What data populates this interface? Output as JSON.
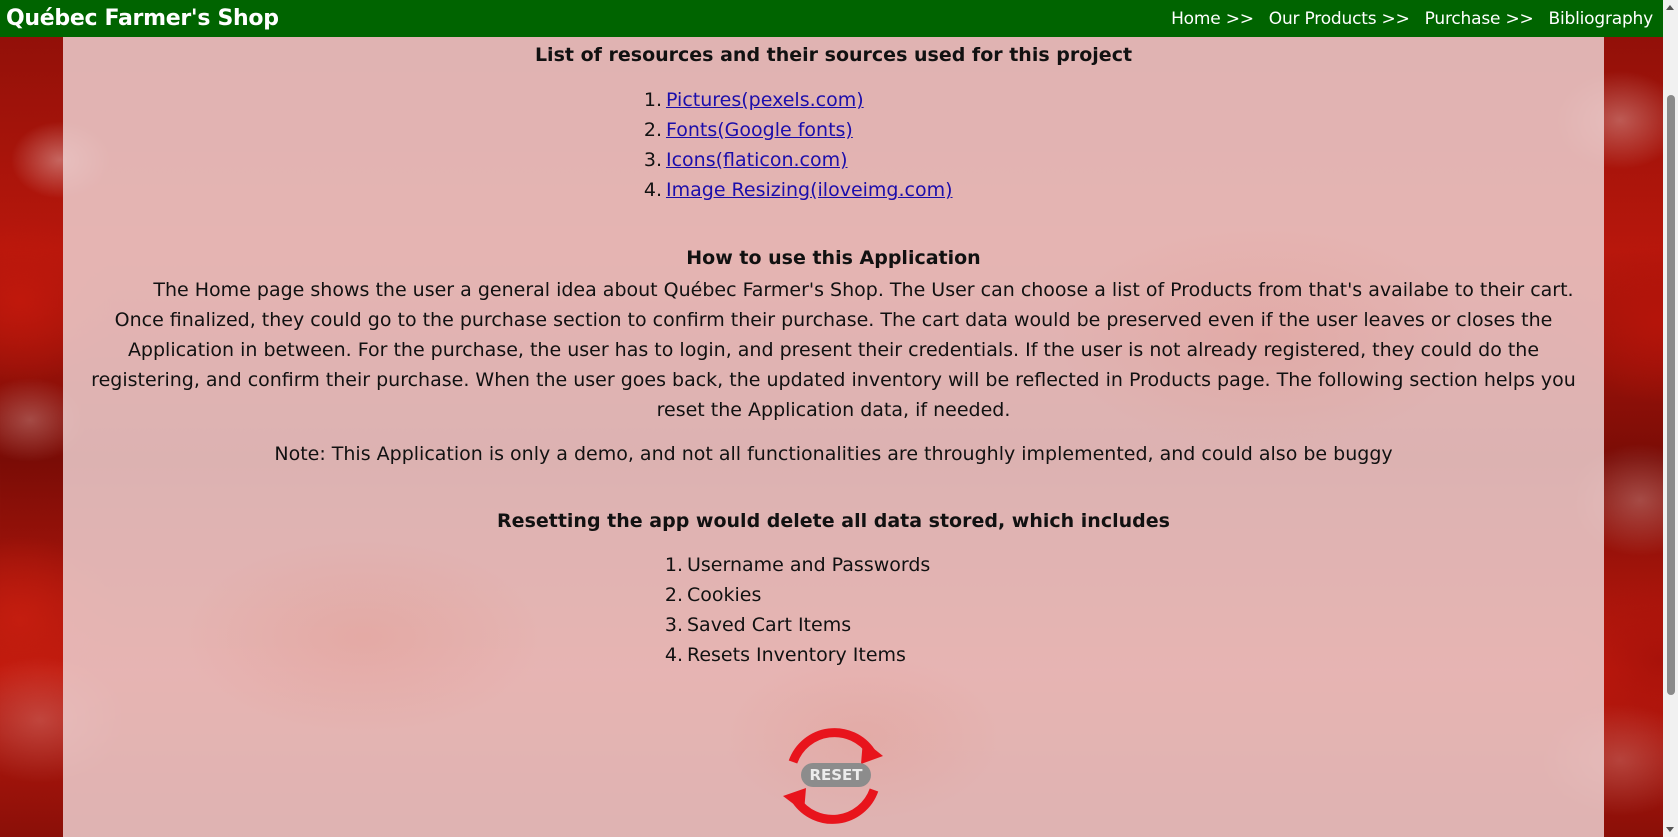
{
  "header": {
    "brand": "Québec Farmer's Shop",
    "nav": [
      {
        "label": "Home >>"
      },
      {
        "label": "Our Products >>"
      },
      {
        "label": "Purchase >>"
      },
      {
        "label": "Bibliography"
      }
    ]
  },
  "resources": {
    "heading": "List of resources and their sources used for this project",
    "items": [
      {
        "num": "1.",
        "label": "Pictures(pexels.com)"
      },
      {
        "num": "2.",
        "label": "Fonts(Google fonts)"
      },
      {
        "num": "3.",
        "label": "Icons(flaticon.com)"
      },
      {
        "num": "4.",
        "label": "Image Resizing(iloveimg.com)"
      }
    ]
  },
  "howto": {
    "heading": "How to use this Application",
    "text": "The Home page shows the user a general idea about Québec Farmer's Shop. The User can choose a list of Products from that's availabe to their cart. Once finalized, they could go to the purchase section to confirm their purchase. The cart data would be preserved even if the user leaves or closes the Application in between. For the purchase, the user has to login, and present their credentials. If the user is not already registered, they could do the registering, and confirm their purchase. When the user goes back, the updated inventory will be reflected in Products page. The following section helps you reset the Application data, if needed."
  },
  "note": "Note: This Application is only a demo, and not all functionalities are throughly implemented, and could also be buggy",
  "reset": {
    "heading": "Resetting the app would delete all data stored, which includes",
    "items": [
      {
        "num": "1.",
        "label": "Username and Passwords"
      },
      {
        "num": "2.",
        "label": "Cookies"
      },
      {
        "num": "3.",
        "label": "Saved Cart Items"
      },
      {
        "num": "4.",
        "label": "Resets Inventory Items"
      }
    ],
    "button_label": "RESET"
  },
  "colors": {
    "header_bg": "#006400",
    "link": "#1a0dab",
    "reset_ring": "#e8141c"
  }
}
